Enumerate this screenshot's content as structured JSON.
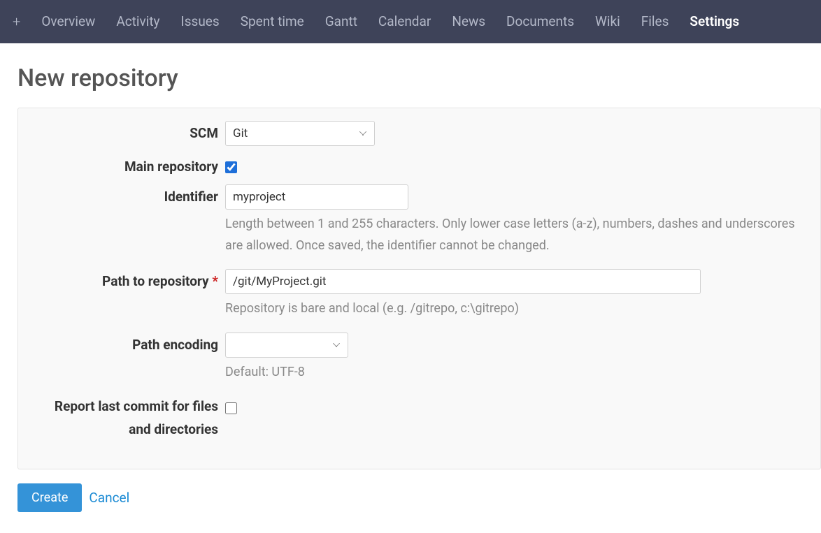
{
  "nav": {
    "plus": "+",
    "items": [
      {
        "label": "Overview",
        "active": false
      },
      {
        "label": "Activity",
        "active": false
      },
      {
        "label": "Issues",
        "active": false
      },
      {
        "label": "Spent time",
        "active": false
      },
      {
        "label": "Gantt",
        "active": false
      },
      {
        "label": "Calendar",
        "active": false
      },
      {
        "label": "News",
        "active": false
      },
      {
        "label": "Documents",
        "active": false
      },
      {
        "label": "Wiki",
        "active": false
      },
      {
        "label": "Files",
        "active": false
      },
      {
        "label": "Settings",
        "active": true
      }
    ]
  },
  "page": {
    "title": "New repository"
  },
  "form": {
    "scm": {
      "label": "SCM",
      "value": "Git"
    },
    "main_repo": {
      "label": "Main repository",
      "checked": true
    },
    "identifier": {
      "label": "Identifier",
      "value": "myproject",
      "help": "Length between 1 and 255 characters. Only lower case letters (a-z), numbers, dashes and underscores are allowed.\nOnce saved, the identifier cannot be changed."
    },
    "path": {
      "label": "Path to repository",
      "required": "*",
      "value": "/git/MyProject.git",
      "help": "Repository is bare and local (e.g. /gitrepo, c:\\gitrepo)"
    },
    "encoding": {
      "label": "Path encoding",
      "value": "",
      "help": "Default: UTF-8"
    },
    "report_last_commit": {
      "label": "Report last commit for files and directories",
      "checked": false
    }
  },
  "actions": {
    "create": "Create",
    "cancel": "Cancel"
  }
}
